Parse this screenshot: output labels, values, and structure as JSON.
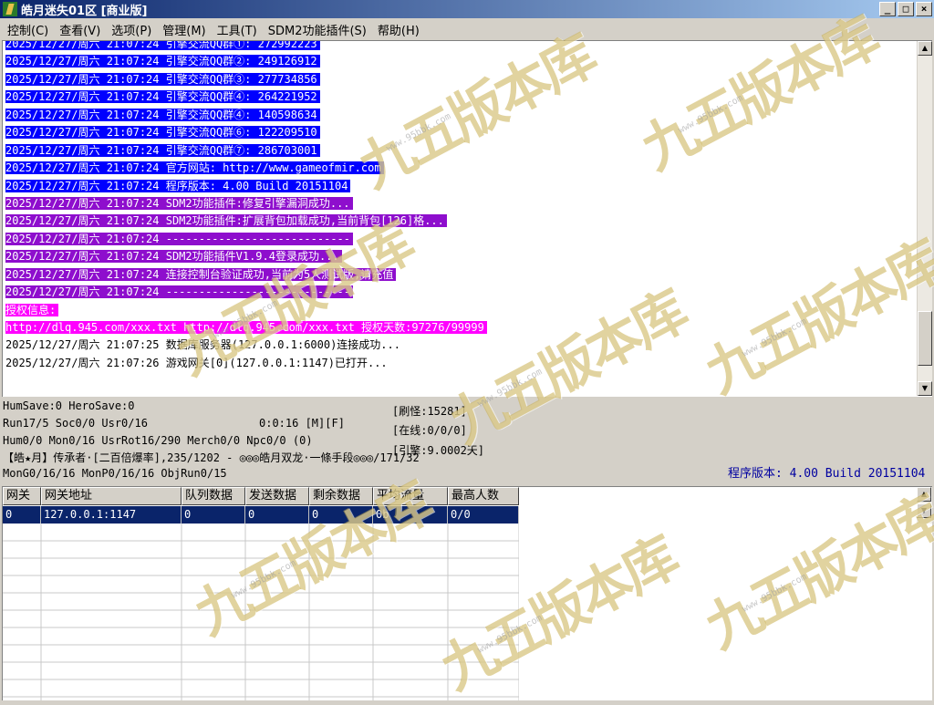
{
  "window": {
    "title": "皓月迷失01区 [商业版]",
    "controls": {
      "minimize": "_",
      "maximize": "□",
      "close": "×"
    }
  },
  "menu": [
    "控制(C)",
    "查看(V)",
    "选项(P)",
    "管理(M)",
    "工具(T)",
    "SDM2功能插件(S)",
    "帮助(H)"
  ],
  "log": [
    {
      "text": "2025/12/27/周六 21:07:24 引擎交流QQ群①: 272992223",
      "style": "blue"
    },
    {
      "text": "2025/12/27/周六 21:07:24 引擎交流QQ群②: 249126912",
      "style": "blue"
    },
    {
      "text": "2025/12/27/周六 21:07:24 引擎交流QQ群③: 277734856",
      "style": "blue"
    },
    {
      "text": "2025/12/27/周六 21:07:24 引擎交流QQ群④: 264221952",
      "style": "blue"
    },
    {
      "text": "2025/12/27/周六 21:07:24 引擎交流QQ群④: 140598634",
      "style": "blue"
    },
    {
      "text": "2025/12/27/周六 21:07:24 引擎交流QQ群⑥: 122209510",
      "style": "blue"
    },
    {
      "text": "2025/12/27/周六 21:07:24 引擎交流QQ群⑦: 286703001",
      "style": "blue"
    },
    {
      "text": "2025/12/27/周六 21:07:24 官方网站: http://www.gameofmir.com",
      "style": "blue"
    },
    {
      "text": "2025/12/27/周六 21:07:24 程序版本: 4.00 Build 20151104",
      "style": "blue"
    },
    {
      "text": "2025/12/27/周六 21:07:24 SDM2功能插件:修复引擎漏洞成功...",
      "style": "purple"
    },
    {
      "text": "2025/12/27/周六 21:07:24 SDM2功能插件:扩展背包加载成功,当前背包[126]格...",
      "style": "purple"
    },
    {
      "text": "2025/12/27/周六 21:07:24 ----------------------------",
      "style": "purple"
    },
    {
      "text": "2025/12/27/周六 21:07:24 SDM2功能插件V1.9.4登录成功...",
      "style": "purple"
    },
    {
      "text": "2025/12/27/周六 21:07:24 连接控制台验证成功,当前为5人测试版,请充值",
      "style": "purple"
    },
    {
      "text": "2025/12/27/周六 21:07:24 ----------------------------",
      "style": "purple"
    },
    {
      "text": "授权信息:",
      "style": "magenta"
    },
    {
      "text": "http://dlq.945.com/xxx.txt http://dlq.945.com/xxx.txt 授权天数:97276/99999",
      "style": "magenta"
    },
    {
      "text": "2025/12/27/周六 21:07:25 数据库服务器(127.0.0.1:6000)连接成功...",
      "style": "none"
    },
    {
      "text": "2025/12/27/周六 21:07:26 游戏网关[0](127.0.0.1:1147)已打开...",
      "style": "none"
    }
  ],
  "status": {
    "line1": "HumSave:0 HeroSave:0",
    "line2_left": "Run17/5 Soc0/0 Usr0/16",
    "line2_time": "0:0:16 [M][F]",
    "line3": "Hum0/0 Mon0/16 UsrRot16/290 Merch0/0 Npc0/0 (0)",
    "line4": "【皓★月】传承者·[二百倍爆率],235/1202 - ◎◎◎皓月双龙·一條手段◎◎◎/171/32",
    "line5": "MonG0/16/16 MonP0/16/16 ObjRun0/15",
    "refresh": "[刷怪:15281]",
    "online": "[在线:0/0/0]",
    "engine": "[引擎:9.0002天]",
    "version": "程序版本: 4.00 Build 20151104"
  },
  "gateway_table": {
    "headers": [
      "网关",
      "网关地址",
      "队列数据",
      "发送数据",
      "剩余数据",
      "平均流量",
      "最高人数"
    ],
    "rows": [
      [
        "0",
        "127.0.0.1:1147",
        "0",
        "0",
        "0",
        "0b",
        "0/0"
      ]
    ]
  },
  "watermark": {
    "text": "九五版本库",
    "url": "www.95bbk.com"
  },
  "colors": {
    "titlebar": "#0a246a",
    "log_blue": "#0000ff",
    "log_purple": "#8e0ecd",
    "log_magenta": "#ff00ff",
    "selected_row": "#0a246a"
  }
}
